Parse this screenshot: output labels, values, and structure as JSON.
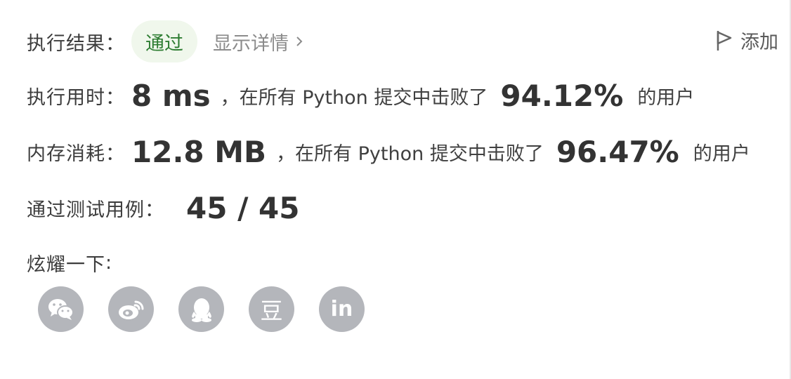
{
  "result": {
    "label": "执行结果",
    "colon": "：",
    "status": "通过",
    "details": "显示详情",
    "add": "添加"
  },
  "runtime": {
    "label": "执行用时",
    "colon": "：",
    "value": "8 ms",
    "mid": "，在所有 Python 提交中击败了",
    "pct": "94.12%",
    "suffix": "的用户"
  },
  "memory": {
    "label": "内存消耗",
    "colon": "：",
    "value": "12.8 MB",
    "mid": "，在所有 Python 提交中击败了",
    "pct": "96.47%",
    "suffix": "的用户"
  },
  "tests": {
    "label": "通过测试用例",
    "colon": "：",
    "value": "45 / 45"
  },
  "share": {
    "label": "炫耀一下",
    "colon": ":",
    "icons": [
      "wechat-icon",
      "weibo-icon",
      "qq-icon",
      "douban-icon",
      "linkedin-icon"
    ],
    "douban_glyph": "豆",
    "linkedin_glyph": "in"
  },
  "colors": {
    "pass_bg": "#f0f7ec",
    "pass_text": "#2e7d32",
    "icon_bg": "#b4b6bb"
  }
}
